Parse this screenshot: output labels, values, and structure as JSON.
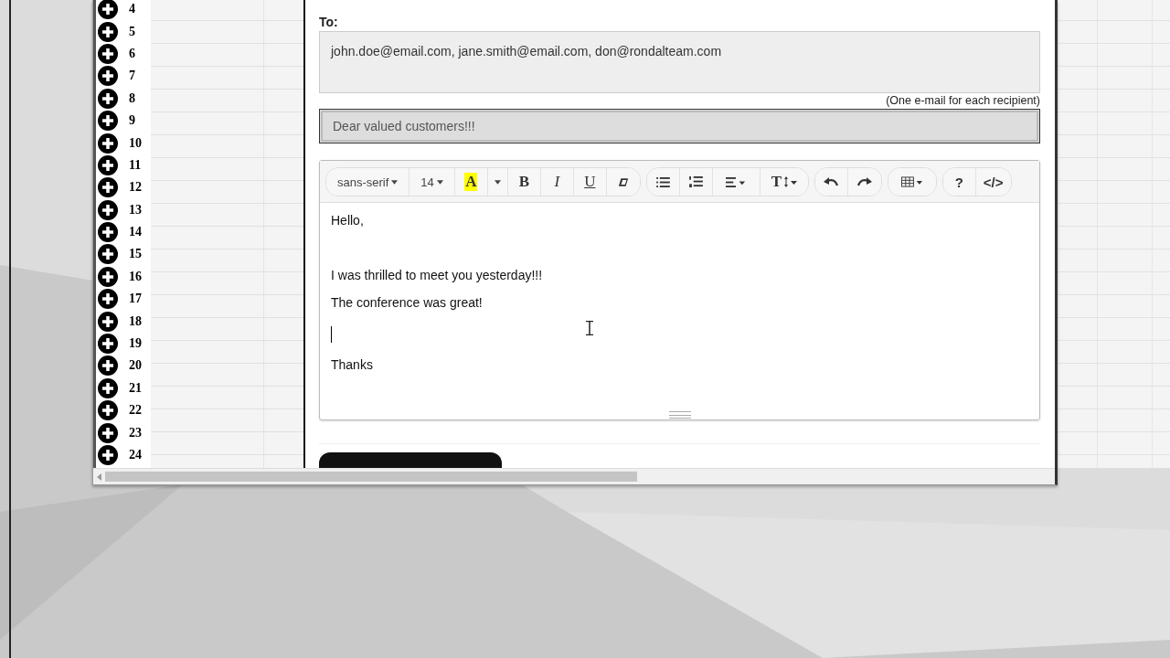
{
  "spreadsheet": {
    "rows": [
      {
        "number": "4"
      },
      {
        "number": "5"
      },
      {
        "number": "6"
      },
      {
        "number": "7"
      },
      {
        "number": "8"
      },
      {
        "number": "9"
      },
      {
        "number": "10"
      },
      {
        "number": "11"
      },
      {
        "number": "12"
      },
      {
        "number": "13"
      },
      {
        "number": "14"
      },
      {
        "number": "15"
      },
      {
        "number": "16"
      },
      {
        "number": "17"
      },
      {
        "number": "18"
      },
      {
        "number": "19"
      },
      {
        "number": "20"
      },
      {
        "number": "21"
      },
      {
        "number": "22"
      },
      {
        "number": "23"
      },
      {
        "number": "24"
      }
    ]
  },
  "email_form": {
    "to_label": "To:",
    "to_field": {
      "value": "john.doe@email.com, jane.smith@email.com, don@rondalteam.com"
    },
    "to_hint": "(One e-mail for each recipient)",
    "subject_field": {
      "value": "Dear valued customers!!!"
    },
    "editor": {
      "toolbar": [
        [
          {
            "kind": "dropdown",
            "label": "sans-serif"
          },
          {
            "kind": "dropdown",
            "label": "14"
          },
          {
            "kind": "highlight",
            "label": "A"
          },
          {
            "kind": "caret"
          },
          {
            "kind": "bold",
            "label": "B"
          },
          {
            "kind": "italic",
            "label": "I"
          },
          {
            "kind": "underline",
            "label": "U"
          },
          {
            "kind": "eraser"
          }
        ],
        [
          {
            "kind": "bullets"
          },
          {
            "kind": "numbers"
          },
          {
            "kind": "align"
          },
          {
            "kind": "textsize",
            "label": "T"
          }
        ],
        [
          {
            "kind": "undo"
          },
          {
            "kind": "redo"
          }
        ],
        [
          {
            "kind": "table"
          }
        ],
        [
          {
            "kind": "plain",
            "label": "?"
          },
          {
            "kind": "plain",
            "label": "</>"
          }
        ]
      ],
      "body": [
        {
          "kind": "text",
          "text": "Hello,"
        },
        {
          "kind": "blank"
        },
        {
          "kind": "text",
          "text": "I was thrilled to meet you yesterday!!!"
        },
        {
          "kind": "text",
          "text": "The conference was great!"
        },
        {
          "kind": "caret"
        },
        {
          "kind": "text",
          "text": "Thanks"
        }
      ]
    },
    "send_button": {
      "kind": "cut-off"
    }
  }
}
